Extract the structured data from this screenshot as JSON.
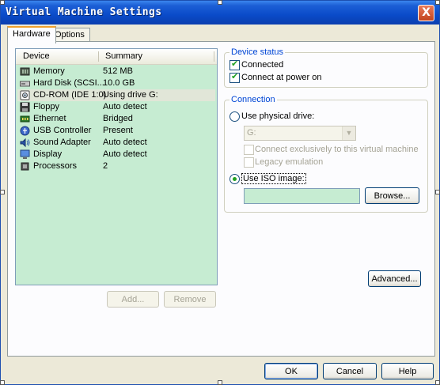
{
  "window": {
    "title": "Virtual Machine Settings",
    "close_label": "X"
  },
  "tabs": [
    {
      "label": "Hardware"
    },
    {
      "label": "Options"
    }
  ],
  "device_list": {
    "headers": {
      "device": "Device",
      "summary": "Summary"
    },
    "rows": [
      {
        "name": "Memory",
        "summary": "512 MB",
        "icon": "memory-icon"
      },
      {
        "name": "Hard Disk (SCSI...",
        "summary": "10.0 GB",
        "icon": "hard-disk-icon"
      },
      {
        "name": "CD-ROM (IDE 1:0)",
        "summary": "Using drive G:",
        "icon": "cdrom-icon"
      },
      {
        "name": "Floppy",
        "summary": "Auto detect",
        "icon": "floppy-icon"
      },
      {
        "name": "Ethernet",
        "summary": "Bridged",
        "icon": "ethernet-icon"
      },
      {
        "name": "USB Controller",
        "summary": "Present",
        "icon": "usb-icon"
      },
      {
        "name": "Sound Adapter",
        "summary": "Auto detect",
        "icon": "sound-icon"
      },
      {
        "name": "Display",
        "summary": "Auto detect",
        "icon": "display-icon"
      },
      {
        "name": "Processors",
        "summary": "2",
        "icon": "processor-icon"
      }
    ],
    "selected_index": 2
  },
  "list_buttons": {
    "add": "Add...",
    "remove": "Remove"
  },
  "device_status": {
    "title": "Device status",
    "connected": "Connected",
    "connect_at_power_on": "Connect at power on"
  },
  "connection": {
    "title": "Connection",
    "use_physical_drive": "Use physical drive:",
    "drive_value": "G:",
    "connect_exclusively": "Connect exclusively to this virtual machine",
    "legacy_emulation": "Legacy emulation",
    "use_iso_image": "Use ISO image:",
    "iso_path": "",
    "browse": "Browse..."
  },
  "advanced_button": "Advanced...",
  "footer": {
    "ok": "OK",
    "cancel": "Cancel",
    "help": "Help"
  },
  "colors": {
    "title_bar": "#0a4bc9",
    "list_bg": "#c6ecd2",
    "group_title": "#0046d5"
  }
}
